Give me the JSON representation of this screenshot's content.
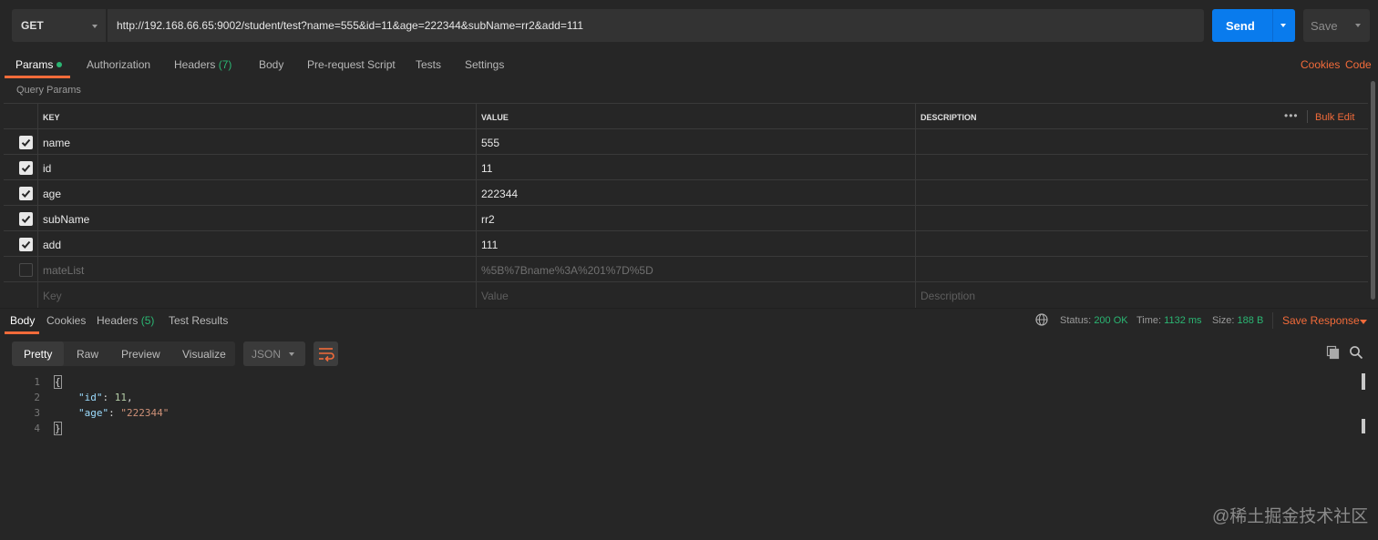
{
  "request": {
    "method": "GET",
    "url": "http://192.168.66.65:9002/student/test?name=555&id=11&age=222344&subName=rr2&add=111",
    "send_label": "Send",
    "save_label": "Save"
  },
  "request_tabs": {
    "params": "Params",
    "authorization": "Authorization",
    "headers": "Headers",
    "headers_count": "(7)",
    "body": "Body",
    "prerequest": "Pre-request Script",
    "tests": "Tests",
    "settings": "Settings",
    "cookies": "Cookies",
    "code": "Code"
  },
  "query_params": {
    "title": "Query Params",
    "headers": {
      "key": "KEY",
      "value": "VALUE",
      "description": "DESCRIPTION"
    },
    "bulk_edit": "Bulk Edit",
    "more": "•••",
    "rows": [
      {
        "key": "name",
        "value": "555",
        "checked": true
      },
      {
        "key": "id",
        "value": "11",
        "checked": true
      },
      {
        "key": "age",
        "value": "222344",
        "checked": true
      },
      {
        "key": "subName",
        "value": "rr2",
        "checked": true
      },
      {
        "key": "add",
        "value": "111",
        "checked": true
      },
      {
        "key": "mateList",
        "value": "%5B%7Bname%3A%201%7D%5D",
        "checked": false
      }
    ],
    "placeholder": {
      "key": "Key",
      "value": "Value",
      "description": "Description"
    }
  },
  "response_tabs": {
    "body": "Body",
    "cookies": "Cookies",
    "headers": "Headers",
    "headers_count": "(5)",
    "test_results": "Test Results"
  },
  "response_meta": {
    "status_label": "Status:",
    "status_value": "200 OK",
    "time_label": "Time:",
    "time_value": "1132 ms",
    "size_label": "Size:",
    "size_value": "188 B",
    "save_response": "Save Response"
  },
  "body_view": {
    "pretty": "Pretty",
    "raw": "Raw",
    "preview": "Preview",
    "visualize": "Visualize",
    "format": "JSON"
  },
  "code": {
    "line_numbers": [
      "1",
      "2",
      "3",
      "4"
    ],
    "open_brace": "{",
    "close_brace": "}",
    "id_key": "\"id\"",
    "id_value": "11",
    "age_key": "\"age\"",
    "age_value": "\"222344\""
  },
  "watermark": "@稀土掘金技术社区",
  "colors": {
    "accent": "#f26b3a",
    "send": "#097bed",
    "success": "#2bb673",
    "background": "#262626"
  }
}
